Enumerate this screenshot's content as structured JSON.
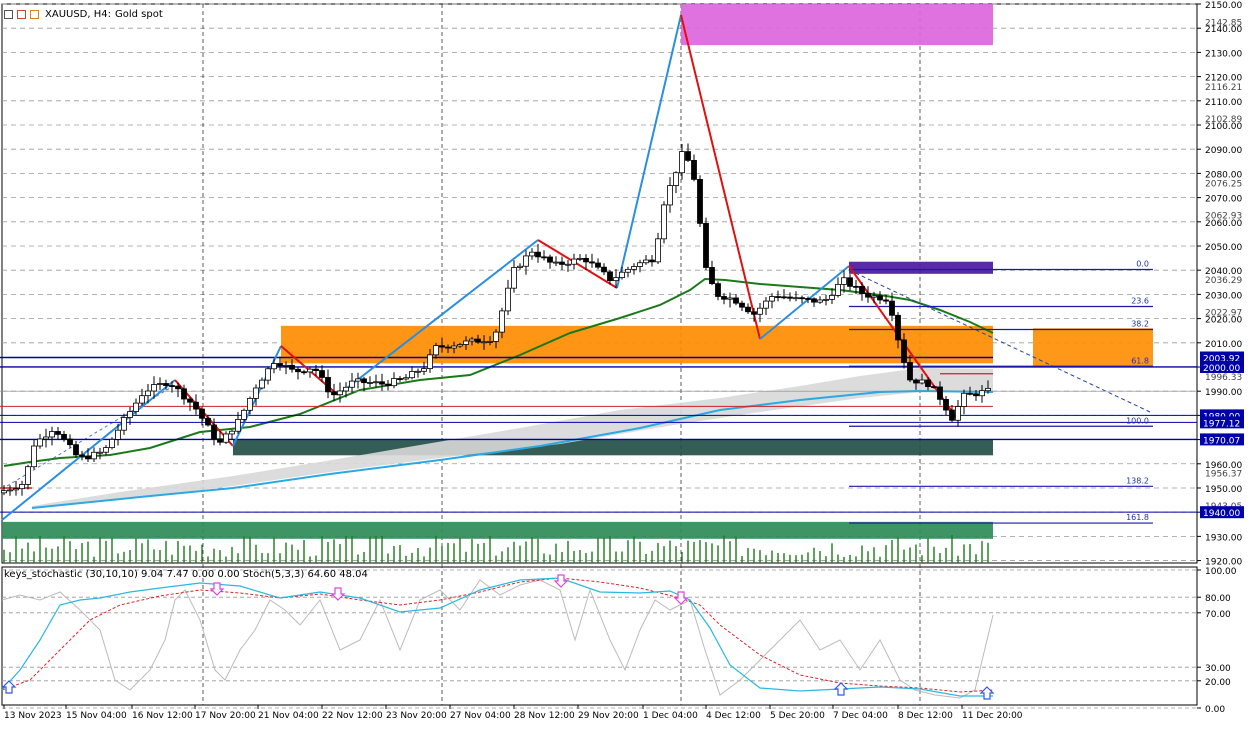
{
  "header": {
    "symbol": "XAUUSD, H4:",
    "description": "Gold spot"
  },
  "indicator_header": {
    "text": "keys_stochastic (30,10,10) 9.04 7.47 0.00 0.00 Stoch(5,3,3) 64.60 48.04"
  },
  "colors": {
    "bull_candle": "#ffffff",
    "bear_candle": "#000000",
    "ema_green": "#1a7a1a",
    "ma_blue": "#2aaae2",
    "zigzag_up": "#2b8ee0",
    "zigzag_down": "#e01010",
    "cloud": "#d8d8d8",
    "zone_orange": "#ff8c00",
    "zone_magenta": "#dd66dd",
    "zone_purple": "#4b1a9e",
    "zone_darkgreen": "#234f47",
    "zone_green": "#2e8b57",
    "fib_line": "#1a1aaa",
    "level_line": "#0000aa",
    "stoch_main": "#2ab8e0",
    "stoch_signal": "#dd2222",
    "keys_line": "#bbbbbb",
    "arrow_up": "#3355ee",
    "arrow_down": "#dd44dd"
  },
  "chart_data": {
    "type": "candlestick",
    "symbol": "XAUUSD",
    "timeframe": "H4",
    "ylim": [
      1919,
      2150
    ],
    "price_ticks": [
      1920.0,
      1930.0,
      1940.0,
      1950.0,
      1960.0,
      1970.0,
      1980.0,
      1990.0,
      2000.0,
      2010.0,
      2020.0,
      2030.0,
      2040.0,
      2050.0,
      2060.0,
      2070.0,
      2080.0,
      2090.0,
      2100.0,
      2110.0,
      2120.0,
      2130.0,
      2140.0,
      2150.0
    ],
    "special_ticks": [
      "2142.85",
      "2116.21",
      "2102.89",
      "2076.25",
      "2062.93",
      "2036.29",
      "2022.97",
      "1996.33",
      "1943.05",
      "1956.37"
    ],
    "highlight_labels": [
      {
        "price": 2003.92,
        "label": "2003.92"
      },
      {
        "price": 2000.0,
        "label": "2000.00"
      },
      {
        "price": 1980.0,
        "label": "1980.00"
      },
      {
        "price": 1977.12,
        "label": "1977.12"
      },
      {
        "price": 1970.07,
        "label": "1970.07"
      },
      {
        "price": 1940.0,
        "label": "1940.00"
      }
    ],
    "time_labels": [
      "13 Nov 2023",
      "15 Nov 04:00",
      "16 Nov 12:00",
      "17 Nov 20:00",
      "21 Nov 04:00",
      "22 Nov 12:00",
      "23 Nov 20:00",
      "27 Nov 04:00",
      "28 Nov 12:00",
      "29 Nov 20:00",
      "1 Dec 04:00",
      "4 Dec 12:00",
      "5 Dec 20:00",
      "7 Dec 04:00",
      "8 Dec 12:00",
      "11 Dec 20:00"
    ],
    "fib_levels": [
      {
        "label": "0.0",
        "price": 2040.3
      },
      {
        "label": "23.6",
        "price": 2025.0
      },
      {
        "label": "38.2",
        "price": 2015.5
      },
      {
        "label": "61.8",
        "price": 2000.3
      },
      {
        "label": "100.0",
        "price": 1975.5
      },
      {
        "label": "138.2",
        "price": 1950.7
      },
      {
        "label": "161.8",
        "price": 1935.5
      }
    ],
    "zones": [
      {
        "name": "supply-top",
        "from_price": 2133,
        "to_price": 2150
      },
      {
        "name": "orange-big",
        "from_price": 2001.5,
        "to_price": 2017
      },
      {
        "name": "orange-right",
        "from_price": 2000,
        "to_price": 2016
      },
      {
        "name": "purple",
        "from_price": 2038.5,
        "to_price": 2043.5
      },
      {
        "name": "dark-green",
        "from_price": 1963.5,
        "to_price": 1970
      },
      {
        "name": "green",
        "from_price": 1929,
        "to_price": 1936
      }
    ],
    "stochastic": {
      "name": "Stoch(5,3,3)",
      "main": 64.6,
      "signal": 48.04,
      "levels": [
        100.0,
        80.0,
        70.0,
        30.0,
        20.0,
        0.0
      ]
    },
    "keys_stochastic": {
      "params": "(30,10,10)",
      "values": [
        9.04,
        7.47,
        0.0,
        0.0
      ]
    }
  }
}
